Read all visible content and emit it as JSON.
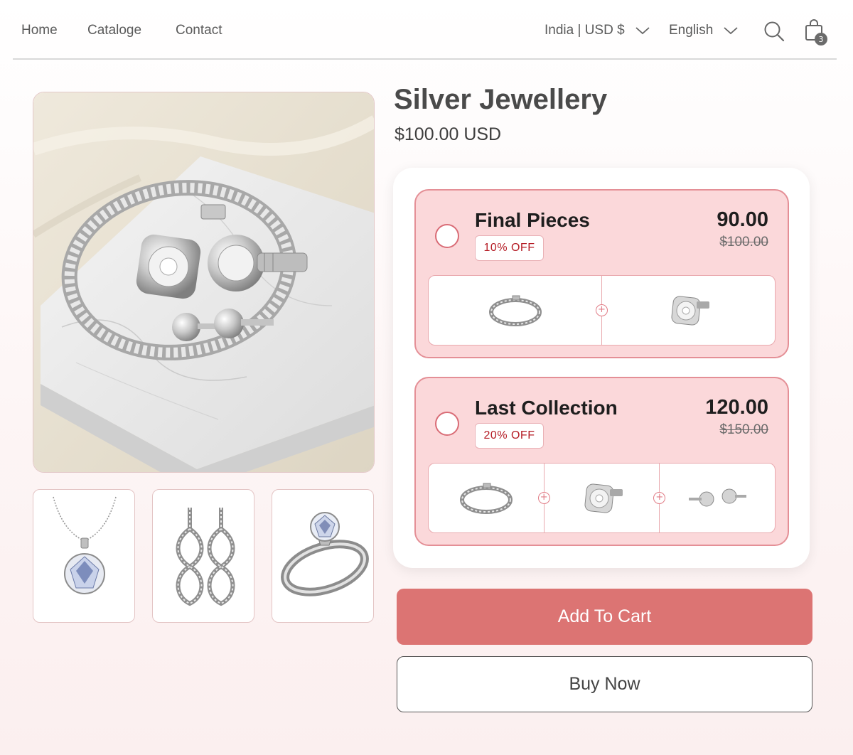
{
  "nav": {
    "links": [
      "Home",
      "Cataloge",
      "Contact"
    ],
    "country_currency": "India | USD $",
    "language": "English",
    "cart_count": "3"
  },
  "product": {
    "title": "Silver Jewellery",
    "price": "$100.00 USD"
  },
  "gallery": {
    "main_image": "silver-jewellery-set-on-marble",
    "thumbnails": [
      "pendant-necklace",
      "infinity-drop-earrings",
      "solitaire-ring"
    ]
  },
  "offers": [
    {
      "name": "Final Pieces",
      "badge": "10% OFF",
      "price": "90.00",
      "old_price": "$100.00",
      "items": [
        "tennis-bracelet",
        "cluster-stud-earring"
      ]
    },
    {
      "name": "Last Collection",
      "badge": "20% OFF",
      "price": "120.00",
      "old_price": "$150.00",
      "items": [
        "tennis-bracelet",
        "cluster-stud-earring",
        "ball-stud-earrings"
      ]
    }
  ],
  "buttons": {
    "add_to_cart": "Add To Cart",
    "buy_now": "Buy Now"
  },
  "colors": {
    "accent": "#dc7473",
    "offer_bg": "#fbd8da",
    "offer_border": "#e48f96",
    "badge_text": "#b51c25"
  },
  "icons": {
    "search": "search-icon",
    "cart": "shopping-bag-icon",
    "chevron": "chevron-down-icon"
  }
}
